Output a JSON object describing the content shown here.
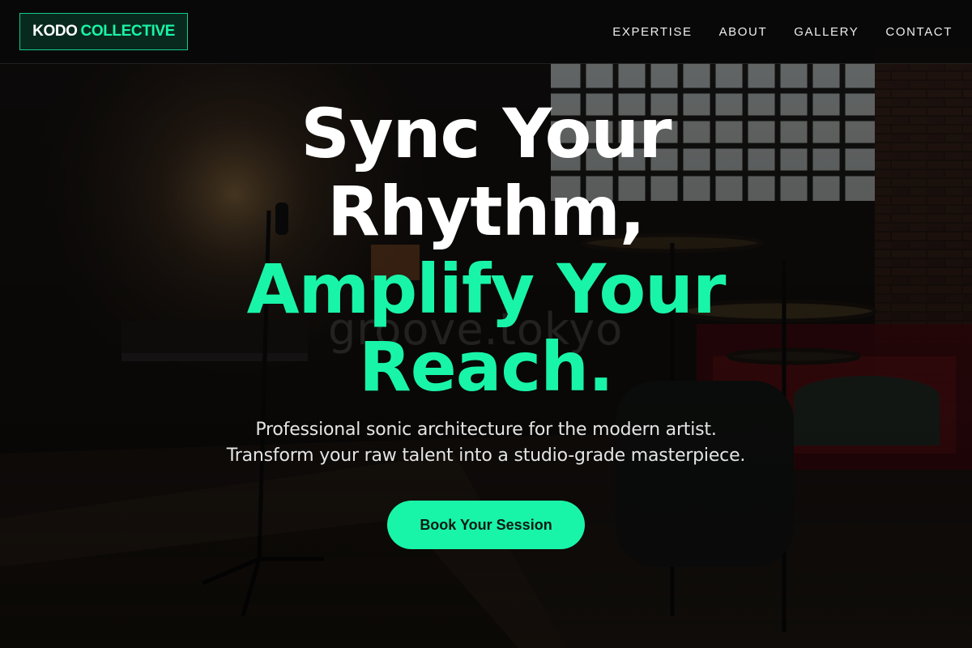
{
  "brand": {
    "name_part1": "KODO",
    "name_part2": "COLLECTIVE"
  },
  "nav": {
    "items": [
      {
        "label": "EXPERTISE"
      },
      {
        "label": "ABOUT"
      },
      {
        "label": "GALLERY"
      },
      {
        "label": "CONTACT"
      }
    ]
  },
  "hero": {
    "headline_line1": "Sync Your",
    "headline_line2": "Rhythm,",
    "headline_line3": "Amplify Your",
    "headline_line4": "Reach.",
    "subtitle_line1": "Professional sonic architecture for the modern artist.",
    "subtitle_line2": "Transform your raw talent into a studio-grade masterpiece.",
    "cta_label": "Book Your Session",
    "background_watermark": "groove.tokyo"
  },
  "colors": {
    "accent": "#19f5a8",
    "background": "#0b0b0b",
    "header_bg": "#080808",
    "text": "#ffffff"
  }
}
